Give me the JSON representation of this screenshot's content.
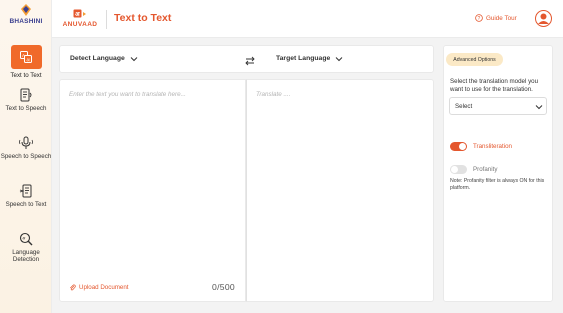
{
  "sidebar": {
    "brand": "BHASHINI",
    "items": [
      {
        "label": "Text to Text",
        "icon": "text-translate-icon",
        "active": true
      },
      {
        "label": "Text to Speech",
        "icon": "text-to-speech-icon",
        "active": false
      },
      {
        "label": "Speech to Speech",
        "icon": "speech-to-speech-icon",
        "active": false
      },
      {
        "label": "Speech to Text",
        "icon": "speech-to-text-icon",
        "active": false
      },
      {
        "label": "Language Detection",
        "icon": "language-detection-icon",
        "active": false
      }
    ]
  },
  "header": {
    "logo_text": "ANUVAAD",
    "title": "Text to Text",
    "guide_tour": "Guide Tour"
  },
  "translator": {
    "source_language": "Detect Language",
    "target_language": "Target Language",
    "source_placeholder": "Enter the text you want to translate here...",
    "target_placeholder": "Translate ....",
    "upload_label": "Upload Document",
    "char_count": "0/500"
  },
  "options": {
    "badge": "Advanced Options",
    "model_description": "Select the translation model you want to use for the translation.",
    "model_select": "Select",
    "transliteration_label": "Transliteration",
    "transliteration_on": true,
    "profanity_label": "Profanity",
    "profanity_on": false,
    "note": "Note: Profanity filter is always ON for this platform."
  },
  "colors": {
    "accent": "#e4572e",
    "active_tile": "#f06a2a",
    "brand_blue": "#3a3f8f",
    "badge_bg": "#fbe9c6"
  }
}
